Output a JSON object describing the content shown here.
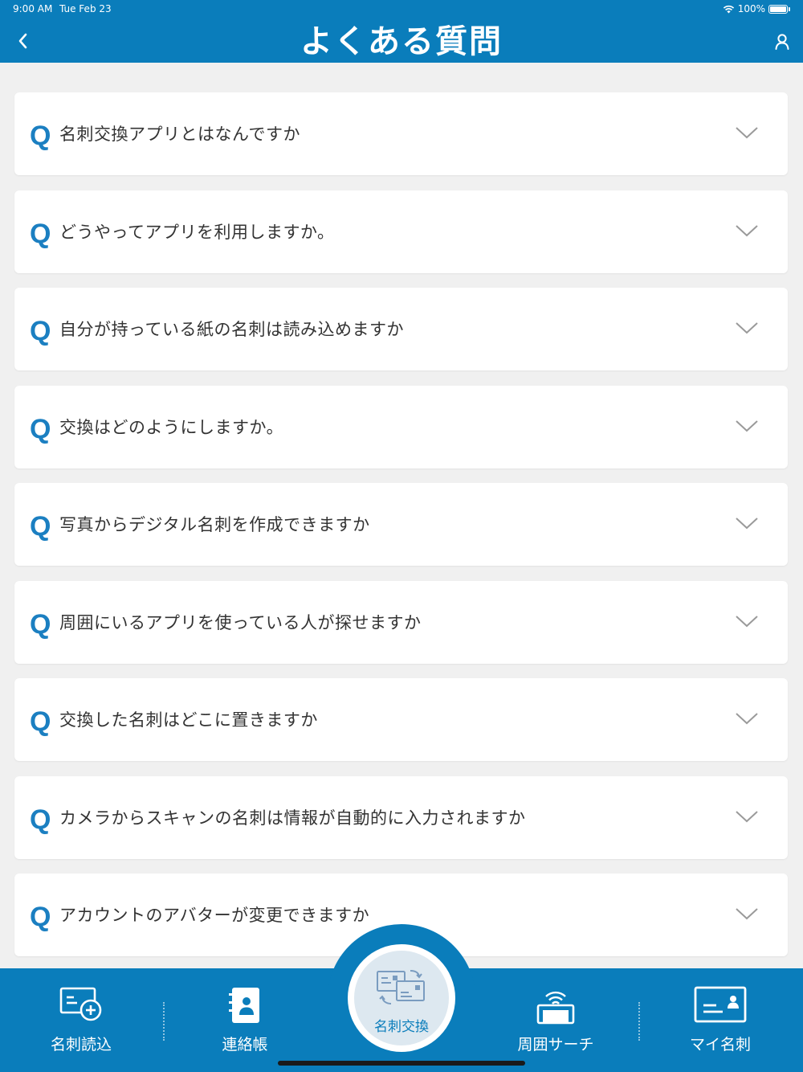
{
  "status_bar": {
    "time": "9:00 AM",
    "date": "Tue Feb 23",
    "battery": "100%"
  },
  "header": {
    "title": "よくある質問",
    "back_icon": "chevron-left-icon",
    "user_icon": "user-icon"
  },
  "faq": {
    "q_mark": "Q",
    "items": [
      {
        "question": "名刺交換アプリとはなんですか"
      },
      {
        "question": "どうやってアプリを利用しますか。"
      },
      {
        "question": "自分が持っている紙の名刺は読み込めますか"
      },
      {
        "question": "交換はどのようにしますか。"
      },
      {
        "question": "写真からデジタル名刺を作成できますか"
      },
      {
        "question": "周囲にいるアプリを使っている人が探せますか"
      },
      {
        "question": "交換した名刺はどこに置きますか"
      },
      {
        "question": "カメラからスキャンの名刺は情報が自動的に入力されますか"
      },
      {
        "question": "アカウントのアバターが変更できますか"
      }
    ]
  },
  "tabbar": {
    "tabs": [
      {
        "label": "名刺読込",
        "icon": "card-add-icon"
      },
      {
        "label": "連絡帳",
        "icon": "contacts-book-icon"
      },
      {
        "label": "名刺交換",
        "icon": "card-exchange-icon"
      },
      {
        "label": "周囲サーチ",
        "icon": "nearby-search-icon"
      },
      {
        "label": "マイ名刺",
        "icon": "my-card-icon"
      }
    ]
  },
  "colors": {
    "primary": "#0a7dbb",
    "accent_q": "#1b7fc1",
    "background": "#f0f0f0"
  }
}
